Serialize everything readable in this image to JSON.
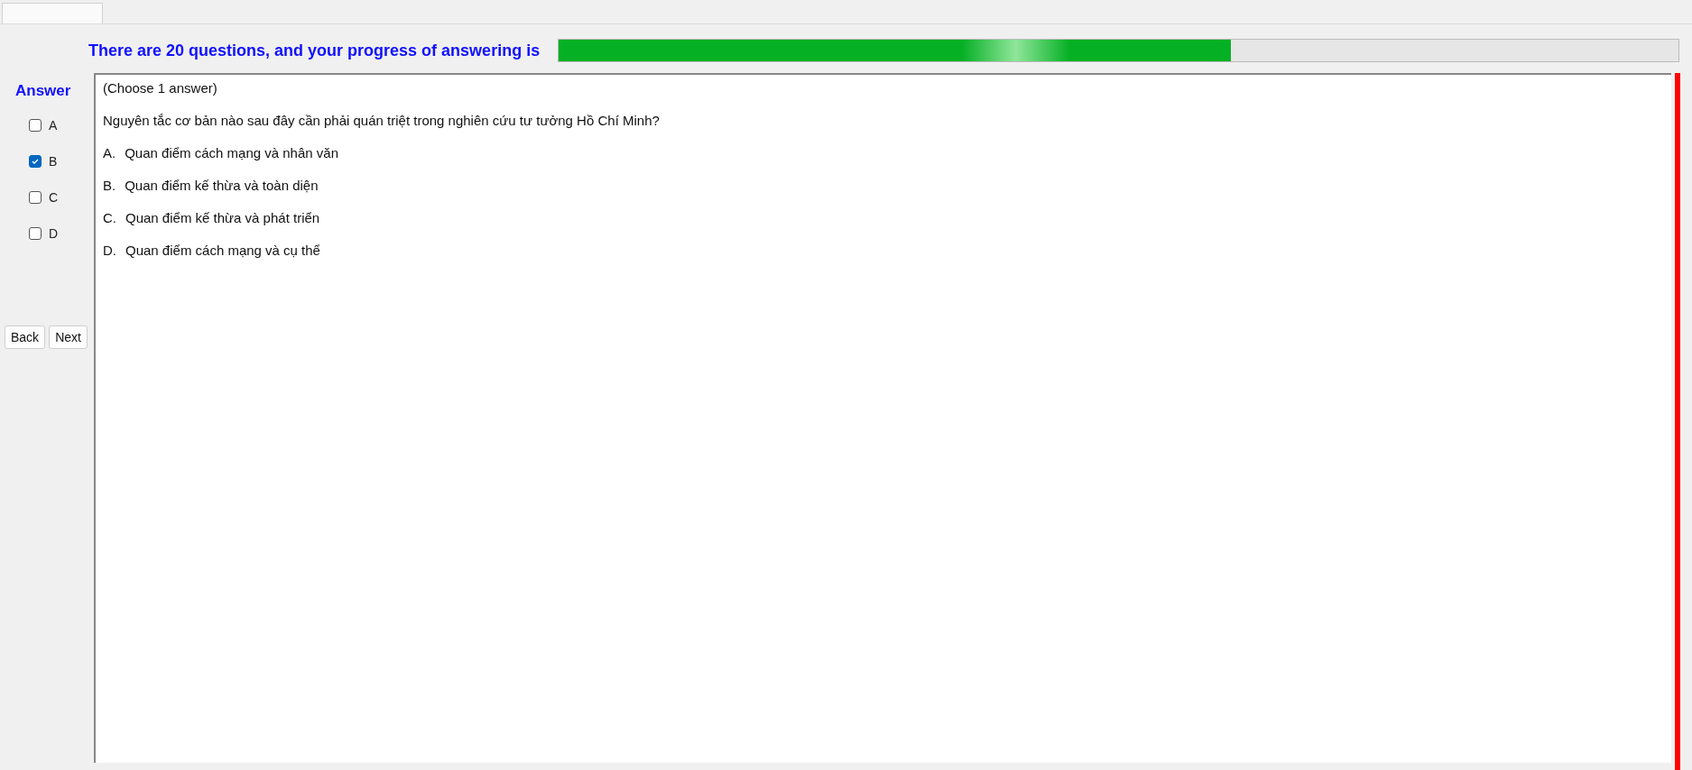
{
  "header": {
    "text": "There are 20 questions, and your progress of answering is",
    "progress": {
      "level": 0.6
    }
  },
  "answer_panel": {
    "title": "Answer",
    "options": [
      {
        "label": "A",
        "checked": false
      },
      {
        "label": "B",
        "checked": true
      },
      {
        "label": "C",
        "checked": false
      },
      {
        "label": "D",
        "checked": false
      }
    ],
    "buttons": [
      "Back",
      "Next"
    ]
  },
  "question": {
    "instruction": "(Choose 1 answer)",
    "text": "Nguyên tắc cơ bản nào sau đây cần phải quán triệt trong nghiên cứu tư tưởng Hồ Chí Minh?",
    "choices": [
      {
        "letter": "A.",
        "text": "Quan điểm cách mạng và nhân văn"
      },
      {
        "letter": "B.",
        "text": "Quan điểm kế thừa và toàn diện"
      },
      {
        "letter": "C.",
        "text": "Quan điểm kế thừa và phát triển"
      },
      {
        "letter": "D.",
        "text": "Quan điểm cách mạng và cụ thể"
      }
    ]
  }
}
